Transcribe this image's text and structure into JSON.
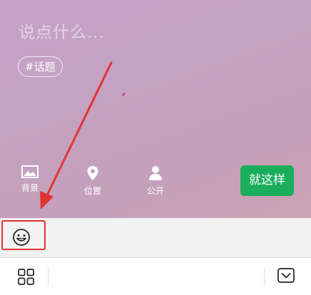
{
  "composer": {
    "placeholder": "说点什么...",
    "topic_tag": "#话题"
  },
  "tools": [
    {
      "label": "背景",
      "icon": "image-icon"
    },
    {
      "label": "位置",
      "icon": "location-pin-icon"
    },
    {
      "label": "公开",
      "icon": "person-icon"
    }
  ],
  "confirm_button": {
    "label": "就这样",
    "color": "#1aad5c"
  },
  "emoji_bar": {
    "icon": "smiley-icon"
  },
  "annotation": {
    "color": "#e23333"
  },
  "bottom_bar": {
    "left_icon": "grid-icon",
    "right_icon": "keyboard-collapse-icon"
  }
}
